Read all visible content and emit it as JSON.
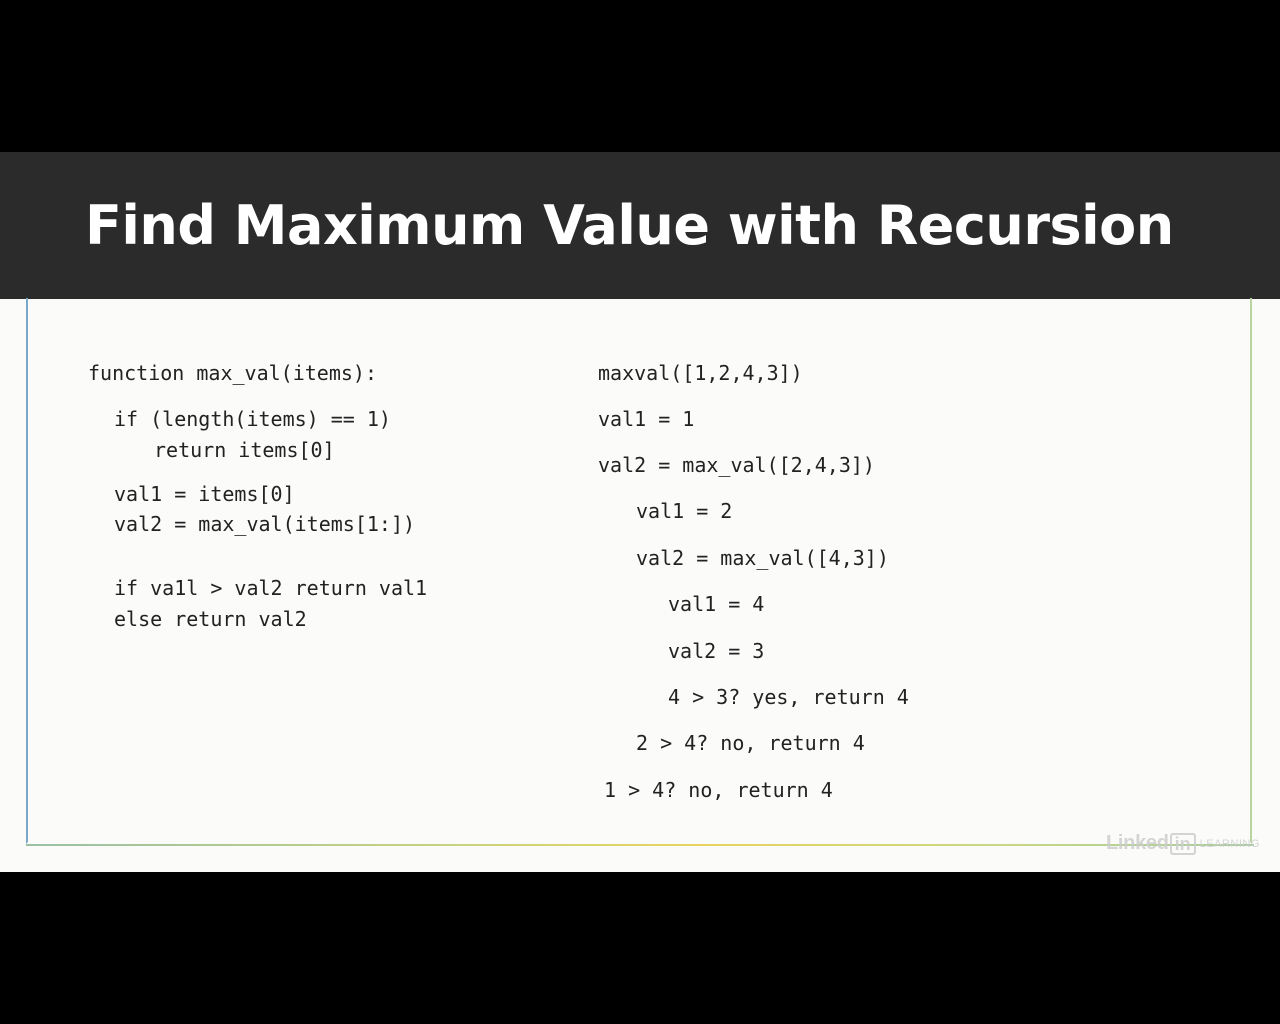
{
  "slide": {
    "title": "Find Maximum Value with Recursion",
    "pseudocode": [
      "function max_val(items):",
      "if (length(items) == 1)",
      "return items[0]",
      "val1 = items[0]",
      "val2 = max_val(items[1:])",
      "if va1l > val2 return val1",
      "else return val2"
    ],
    "trace": [
      "maxval([1,2,4,3])",
      "val1 = 1",
      "val2 = max_val([2,4,3])",
      "val1 = 2",
      "val2 = max_val([4,3])",
      "val1 = 4",
      "val2 = 3",
      "4 > 3? yes, return 4",
      "2 > 4? no, return 4",
      "1 > 4? no, return 4"
    ]
  },
  "watermark": {
    "brand_word": "Linked",
    "brand_box": "in",
    "product": "LEARNING"
  },
  "colors": {
    "title_band": "#2b2b2b",
    "slide_background": "#fbfbfa",
    "letterbox": "#000000"
  }
}
